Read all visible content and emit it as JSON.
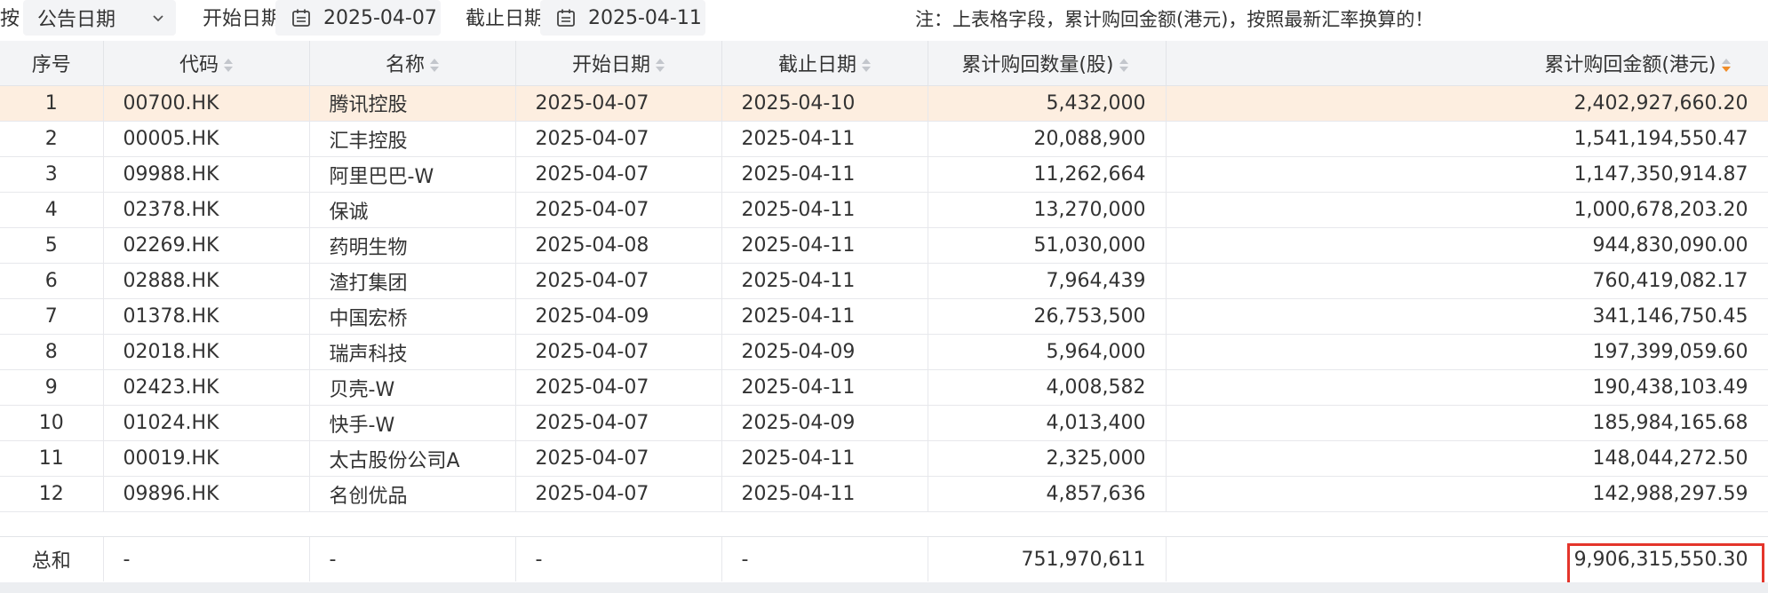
{
  "filter": {
    "prefix": "按",
    "type_select": "公告日期",
    "start_label": "开始日期",
    "start_value": "2025-04-07",
    "end_label": "截止日期",
    "end_value": "2025-04-11",
    "note": "注：上表格字段，累计购回金额(港元)，按照最新汇率换算的！"
  },
  "table": {
    "headers": [
      "序号",
      "代码",
      "名称",
      "开始日期",
      "截止日期",
      "累计购回数量(股)",
      "累计购回金额(港元)"
    ],
    "rows": [
      [
        "1",
        "00700.HK",
        "腾讯控股",
        "2025-04-07",
        "2025-04-10",
        "5,432,000",
        "2,402,927,660.20"
      ],
      [
        "2",
        "00005.HK",
        "汇丰控股",
        "2025-04-07",
        "2025-04-11",
        "20,088,900",
        "1,541,194,550.47"
      ],
      [
        "3",
        "09988.HK",
        "阿里巴巴-W",
        "2025-04-07",
        "2025-04-11",
        "11,262,664",
        "1,147,350,914.87"
      ],
      [
        "4",
        "02378.HK",
        "保诚",
        "2025-04-07",
        "2025-04-11",
        "13,270,000",
        "1,000,678,203.20"
      ],
      [
        "5",
        "02269.HK",
        "药明生物",
        "2025-04-08",
        "2025-04-11",
        "51,030,000",
        "944,830,090.00"
      ],
      [
        "6",
        "02888.HK",
        "渣打集团",
        "2025-04-07",
        "2025-04-11",
        "7,964,439",
        "760,419,082.17"
      ],
      [
        "7",
        "01378.HK",
        "中国宏桥",
        "2025-04-09",
        "2025-04-11",
        "26,753,500",
        "341,146,750.45"
      ],
      [
        "8",
        "02018.HK",
        "瑞声科技",
        "2025-04-07",
        "2025-04-09",
        "5,964,000",
        "197,399,059.60"
      ],
      [
        "9",
        "02423.HK",
        "贝壳-W",
        "2025-04-07",
        "2025-04-11",
        "4,008,582",
        "190,438,103.49"
      ],
      [
        "10",
        "01024.HK",
        "快手-W",
        "2025-04-07",
        "2025-04-09",
        "4,013,400",
        "185,984,165.68"
      ],
      [
        "11",
        "00019.HK",
        "太古股份公司A",
        "2025-04-07",
        "2025-04-11",
        "2,325,000",
        "148,044,272.50"
      ],
      [
        "12",
        "09896.HK",
        "名创优品",
        "2025-04-07",
        "2025-04-11",
        "4,857,636",
        "142,988,297.59"
      ]
    ],
    "footer": [
      "总和",
      "-",
      "-",
      "-",
      "-",
      "751,970,611",
      "9,906,315,550.30"
    ]
  },
  "colors": {
    "highlight_row": "#fdeee0",
    "header_bg": "#f3f4f6",
    "sort_active": "#f08c28",
    "total_box": "#e4352b"
  }
}
